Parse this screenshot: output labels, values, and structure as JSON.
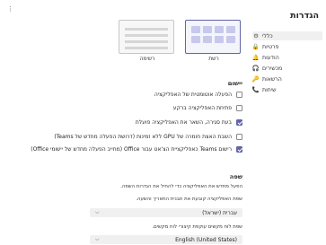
{
  "more_menu": "⋮",
  "nav": {
    "title": "הגדרות",
    "items": [
      {
        "label": "כללי",
        "icon": "gear-icon",
        "glyph": "⚙"
      },
      {
        "label": "פרטיות",
        "icon": "lock-icon",
        "glyph": "🔒"
      },
      {
        "label": "הודעות",
        "icon": "bell-icon",
        "glyph": "🔔"
      },
      {
        "label": "מכשירים",
        "icon": "devices-icon",
        "glyph": "🎧"
      },
      {
        "label": "הרשאות",
        "icon": "key-icon",
        "glyph": "🔑"
      },
      {
        "label": "שיחות",
        "icon": "phone-icon",
        "glyph": "📞"
      }
    ],
    "active_index": 0
  },
  "layout": {
    "options": [
      {
        "label": "רשת",
        "selected": true
      },
      {
        "label": "רשימה",
        "selected": false
      }
    ]
  },
  "application": {
    "title": "יישום",
    "options": [
      {
        "label": "הפעלה אוטומטית של האפליקציה",
        "checked": false
      },
      {
        "label": "פתיחת האפליקציה ברקע",
        "checked": false
      },
      {
        "label": "בעת סגירה, השאר את האפליקציה פועלת",
        "checked": true
      },
      {
        "label": "השבת האצת חומרה של GPU ללא זמינות (דרושת הפעלה מחדש של Teams)",
        "checked": false
      },
      {
        "label": "רישום Teams כאפליקציית הצ'אט עבור Office (מחייב הפעלה מחדש של יישומי Office)",
        "checked": true
      }
    ]
  },
  "language": {
    "title": "שפה",
    "note": "הפעל מחדש את האפליקציה כדי להחיל את הגדרות השפה.",
    "app_language_label": "שפת האפליקציה קובעת את תבנית התאריך והשעה.",
    "app_language_value": "עברית (ישראל)",
    "keyboard_language_label": "שפת לוח מקשים עוקפת קיצורי לוח מקשים.",
    "keyboard_language_value": "English (United States)"
  }
}
